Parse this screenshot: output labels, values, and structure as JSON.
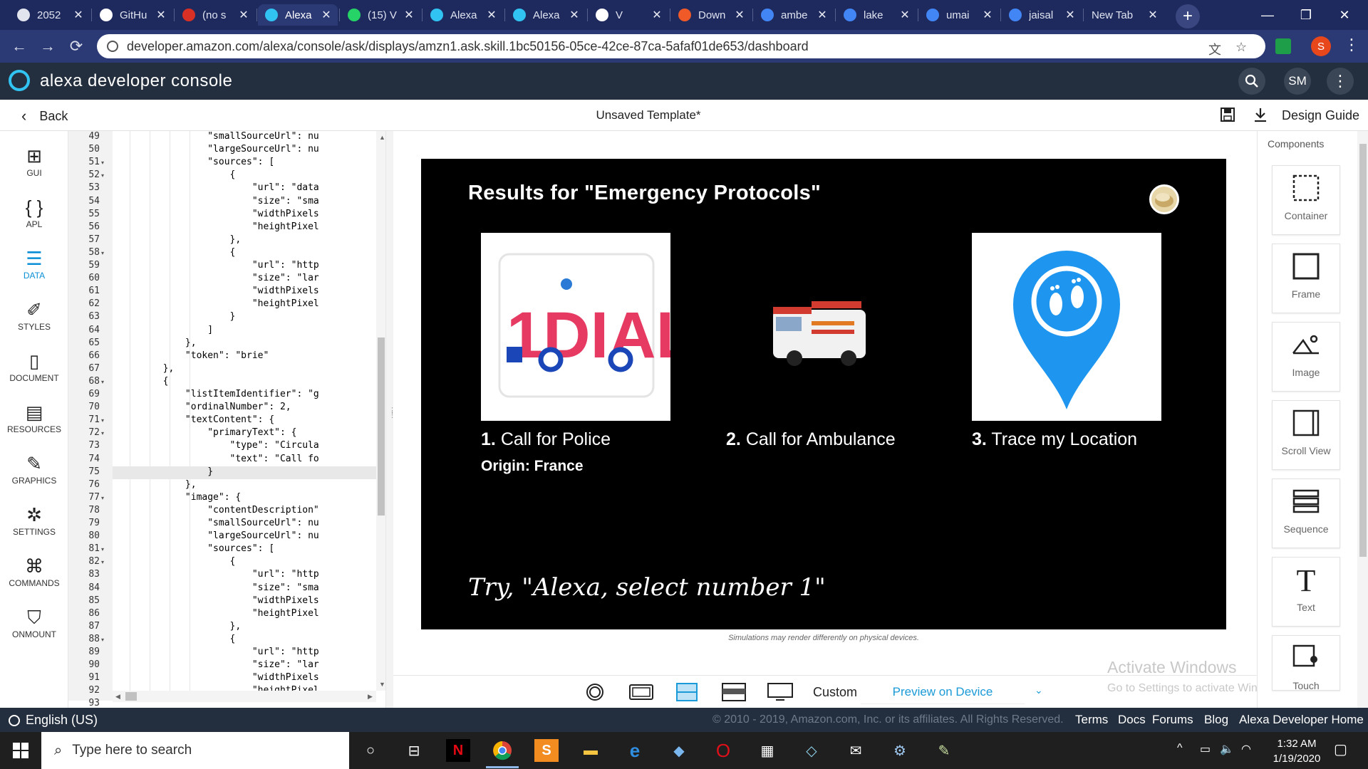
{
  "browser": {
    "tabs": [
      {
        "label": "2052",
        "favicon": "chrome-icon",
        "color": "#e2e5ee"
      },
      {
        "label": "GitHu",
        "favicon": "github-icon",
        "color": "#ffffff"
      },
      {
        "label": "(no s",
        "favicon": "gmail-icon",
        "color": "#d93025"
      },
      {
        "label": "Alexa",
        "favicon": "alexa-icon",
        "color": "#31c4f3"
      },
      {
        "label": "(15) V",
        "favicon": "whatsapp-icon",
        "color": "#25d366"
      },
      {
        "label": "Alexa",
        "favicon": "alexa-icon",
        "color": "#31c4f3"
      },
      {
        "label": "Alexa",
        "favicon": "alexa-icon",
        "color": "#31c4f3"
      },
      {
        "label": "V",
        "favicon": "v-icon",
        "color": "#ffffff"
      },
      {
        "label": "Down",
        "favicon": "g-orange-icon",
        "color": "#f05a28"
      },
      {
        "label": "ambe",
        "favicon": "google-icon",
        "color": "#4285f4"
      },
      {
        "label": "lake",
        "favicon": "google-icon",
        "color": "#4285f4"
      },
      {
        "label": "umai",
        "favicon": "google-icon",
        "color": "#4285f4"
      },
      {
        "label": "jaisal",
        "favicon": "google-icon",
        "color": "#4285f4"
      },
      {
        "label": "New Tab",
        "favicon": "",
        "color": "#ffffff"
      }
    ],
    "url": "developer.amazon.com/alexa/console/ask/displays/amzn1.ask.skill.1bc50156-05ce-42ce-87ca-5afaf01de653/dashboard",
    "profile_initial": "S"
  },
  "app": {
    "title": "alexa developer console",
    "user_initials": "SM",
    "back_label": "Back",
    "template_title": "Unsaved Template*",
    "design_guide": "Design Guide"
  },
  "leftnav": [
    {
      "label": "GUI",
      "icon": "tree-icon"
    },
    {
      "label": "APL",
      "icon": "braces-icon"
    },
    {
      "label": "DATA",
      "icon": "database-icon",
      "active": true
    },
    {
      "label": "STYLES",
      "icon": "brush-icon"
    },
    {
      "label": "DOCUMENT",
      "icon": "document-icon"
    },
    {
      "label": "RESOURCES",
      "icon": "resources-icon"
    },
    {
      "label": "GRAPHICS",
      "icon": "graphics-icon"
    },
    {
      "label": "SETTINGS",
      "icon": "settings-icon"
    },
    {
      "label": "COMMANDS",
      "icon": "command-icon"
    },
    {
      "label": "ONMOUNT",
      "icon": "onmount-icon"
    }
  ],
  "editor": {
    "lines": [
      {
        "n": "49",
        "fold": false,
        "text": "                \"smallSourceUrl\": nu"
      },
      {
        "n": "50",
        "fold": false,
        "text": "                \"largeSourceUrl\": nu"
      },
      {
        "n": "51",
        "fold": true,
        "text": "                \"sources\": ["
      },
      {
        "n": "52",
        "fold": true,
        "text": "                    {"
      },
      {
        "n": "53",
        "fold": false,
        "text": "                        \"url\": \"data"
      },
      {
        "n": "54",
        "fold": false,
        "text": "                        \"size\": \"sma"
      },
      {
        "n": "55",
        "fold": false,
        "text": "                        \"widthPixels"
      },
      {
        "n": "56",
        "fold": false,
        "text": "                        \"heightPixel"
      },
      {
        "n": "57",
        "fold": false,
        "text": "                    },"
      },
      {
        "n": "58",
        "fold": true,
        "text": "                    {"
      },
      {
        "n": "59",
        "fold": false,
        "text": "                        \"url\": \"http"
      },
      {
        "n": "60",
        "fold": false,
        "text": "                        \"size\": \"lar"
      },
      {
        "n": "61",
        "fold": false,
        "text": "                        \"widthPixels"
      },
      {
        "n": "62",
        "fold": false,
        "text": "                        \"heightPixel"
      },
      {
        "n": "63",
        "fold": false,
        "text": "                    }"
      },
      {
        "n": "64",
        "fold": false,
        "text": "                ]"
      },
      {
        "n": "65",
        "fold": false,
        "text": "            },"
      },
      {
        "n": "66",
        "fold": false,
        "text": "            \"token\": \"brie\""
      },
      {
        "n": "67",
        "fold": false,
        "text": "        },"
      },
      {
        "n": "68",
        "fold": true,
        "text": "        {"
      },
      {
        "n": "69",
        "fold": false,
        "text": "            \"listItemIdentifier\": \"g"
      },
      {
        "n": "70",
        "fold": false,
        "text": "            \"ordinalNumber\": 2,"
      },
      {
        "n": "71",
        "fold": true,
        "text": "            \"textContent\": {"
      },
      {
        "n": "72",
        "fold": true,
        "text": "                \"primaryText\": {"
      },
      {
        "n": "73",
        "fold": false,
        "text": "                    \"type\": \"Circula"
      },
      {
        "n": "74",
        "fold": false,
        "text": "                    \"text\": \"Call fo"
      },
      {
        "n": "75",
        "fold": false,
        "text": "                }",
        "highlight": true
      },
      {
        "n": "76",
        "fold": false,
        "text": "            },"
      },
      {
        "n": "77",
        "fold": true,
        "text": "            \"image\": {"
      },
      {
        "n": "78",
        "fold": false,
        "text": "                \"contentDescription\""
      },
      {
        "n": "79",
        "fold": false,
        "text": "                \"smallSourceUrl\": nu"
      },
      {
        "n": "80",
        "fold": false,
        "text": "                \"largeSourceUrl\": nu"
      },
      {
        "n": "81",
        "fold": true,
        "text": "                \"sources\": ["
      },
      {
        "n": "82",
        "fold": true,
        "text": "                    {"
      },
      {
        "n": "83",
        "fold": false,
        "text": "                        \"url\": \"http"
      },
      {
        "n": "84",
        "fold": false,
        "text": "                        \"size\": \"sma"
      },
      {
        "n": "85",
        "fold": false,
        "text": "                        \"widthPixels"
      },
      {
        "n": "86",
        "fold": false,
        "text": "                        \"heightPixel"
      },
      {
        "n": "87",
        "fold": false,
        "text": "                    },"
      },
      {
        "n": "88",
        "fold": true,
        "text": "                    {"
      },
      {
        "n": "89",
        "fold": false,
        "text": "                        \"url\": \"http"
      },
      {
        "n": "90",
        "fold": false,
        "text": "                        \"size\": \"lar"
      },
      {
        "n": "91",
        "fold": false,
        "text": "                        \"widthPixels"
      },
      {
        "n": "92",
        "fold": false,
        "text": "                        \"heightPixel"
      },
      {
        "n": "93",
        "fold": false,
        "text": ""
      }
    ]
  },
  "preview": {
    "title": "Results for \"Emergency Protocols\"",
    "items": [
      {
        "number": "1.",
        "label": "Call for Police",
        "image": "1dial-truck-logo"
      },
      {
        "number": "2.",
        "label": "Call for Ambulance",
        "image": "ambulance-photo"
      },
      {
        "number": "3.",
        "label": "Trace my Location",
        "image": "location-pin-footprints"
      }
    ],
    "secondary": "Origin: France",
    "hint": "Try, \"Alexa, select number 1\"",
    "disclaimer": "Simulations may render differently on physical devices."
  },
  "devicebar": {
    "custom": "Custom",
    "preview_button": "Preview on Device"
  },
  "watermark": {
    "line1": "Activate Windows",
    "line2": "Go to Settings to activate Windows."
  },
  "components": {
    "title": "Components",
    "items": [
      "Container",
      "Frame",
      "Image",
      "Scroll View",
      "Sequence",
      "Text",
      "Touch"
    ]
  },
  "footer": {
    "language": "English (US)",
    "copyright": "© 2010 - 2019, Amazon.com, Inc. or its affiliates. All Rights Reserved.",
    "links": [
      "Terms",
      "Docs",
      "Forums",
      "Blog",
      "Alexa Developer Home"
    ]
  },
  "taskbar": {
    "search_placeholder": "Type here to search",
    "time": "1:32 AM",
    "date": "1/19/2020"
  }
}
